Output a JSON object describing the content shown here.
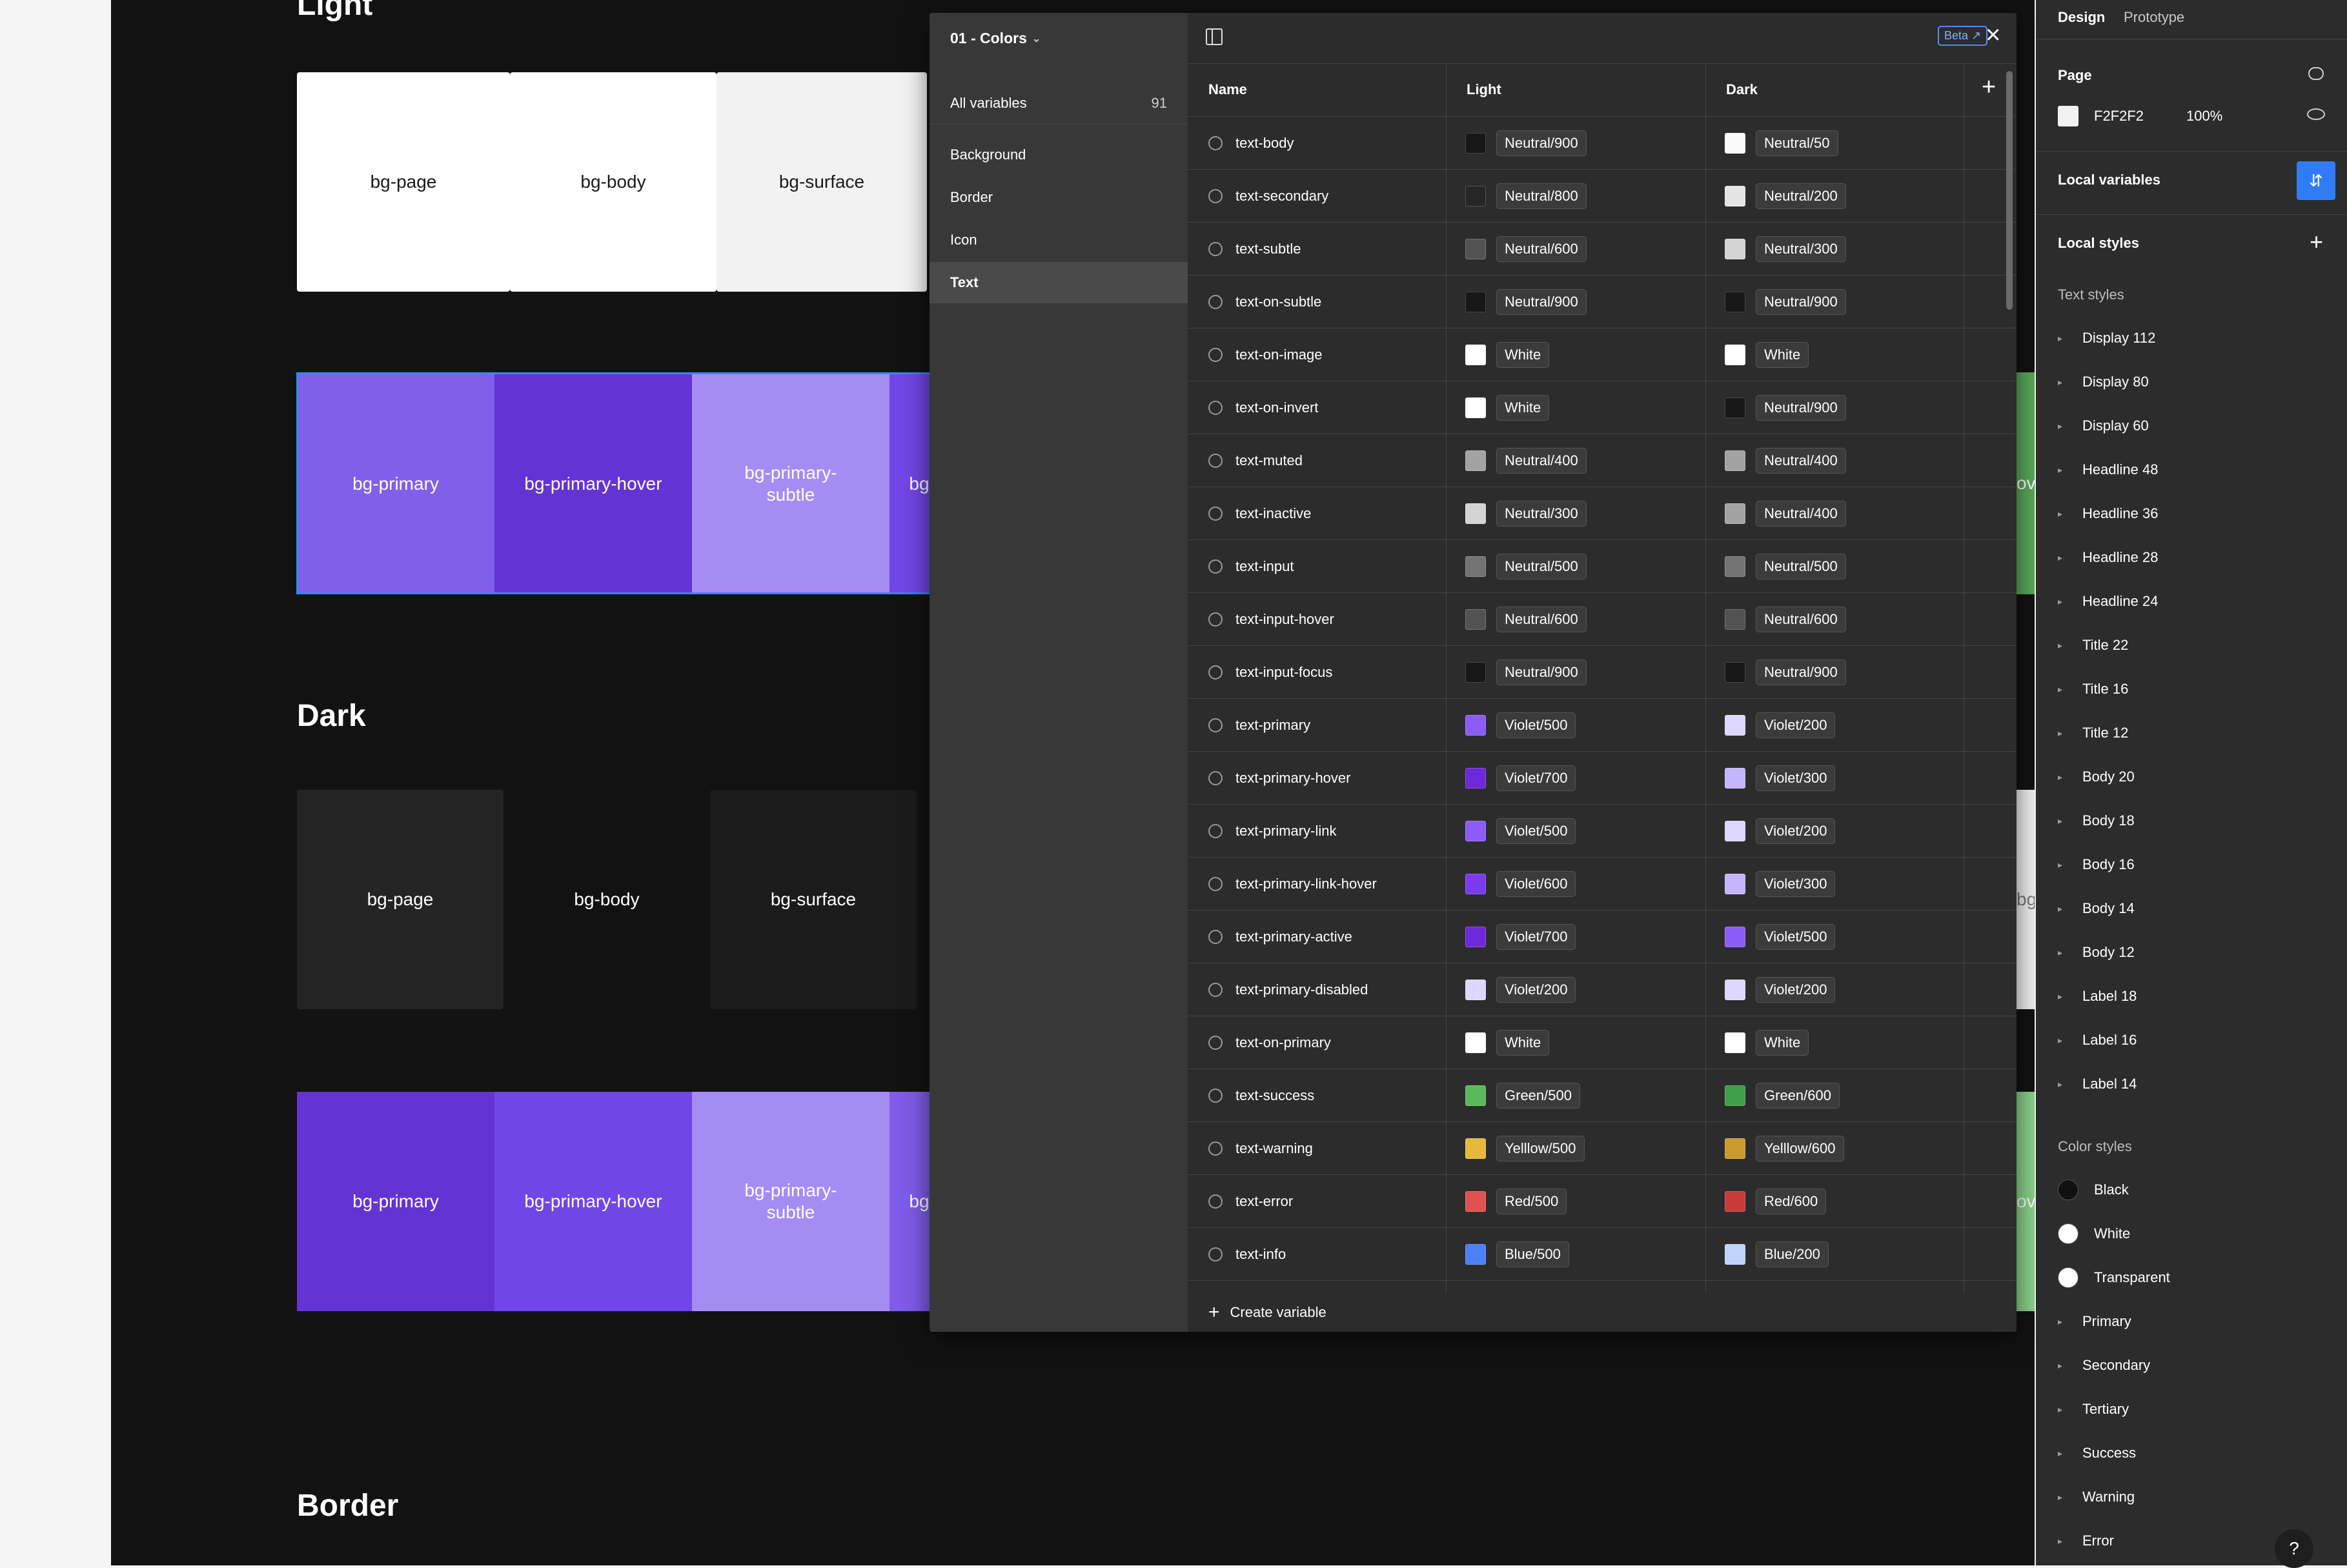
{
  "canvas": {
    "sections": {
      "light": "Light",
      "dark": "Dark",
      "border": "Border"
    },
    "light_neutral": [
      {
        "label": "bg-page",
        "bg": "#ffffff",
        "fg": "#1a1a1a"
      },
      {
        "label": "bg-body",
        "bg": "#ffffff",
        "fg": "#1a1a1a"
      },
      {
        "label": "bg-surface",
        "bg": "#f2f2f2",
        "fg": "#1a1a1a"
      }
    ],
    "light_primary": [
      {
        "label": "bg-primary",
        "bg": "#8060ea",
        "fg": "#ffffff"
      },
      {
        "label": "bg-primary-hover",
        "bg": "#6433d4",
        "fg": "#ffffff"
      },
      {
        "label": "bg-primary-\nsubtle",
        "bg": "#a48cf3",
        "fg": "#ffffff"
      },
      {
        "label": "bg",
        "bg": "#7146e6",
        "fg": "#ffffff"
      }
    ],
    "dark_neutral": [
      {
        "label": "bg-page",
        "bg": "#242424",
        "fg": "#ffffff"
      },
      {
        "label": "bg-body",
        "bg": "#121212",
        "fg": "#ffffff"
      },
      {
        "label": "bg-surface",
        "bg": "#1b1b1b",
        "fg": "#ffffff"
      }
    ],
    "dark_primary": [
      {
        "label": "bg-primary",
        "bg": "#6433d4",
        "fg": "#ffffff"
      },
      {
        "label": "bg-primary-hover",
        "bg": "#7146e6",
        "fg": "#ffffff"
      },
      {
        "label": "bg-primary-\nsubtle",
        "bg": "#a48cf3",
        "fg": "#ffffff"
      },
      {
        "label": "bg",
        "bg": "#7f5ce9",
        "fg": "#ffffff"
      }
    ],
    "peek_right": [
      "ov",
      "bg",
      "ov"
    ]
  },
  "modal": {
    "collection": "01 - Colors",
    "all_variables": "All variables",
    "count": "91",
    "groups": [
      "Background",
      "Border",
      "Icon",
      "Text"
    ],
    "active_group": "Text",
    "beta": "Beta",
    "columns": {
      "name": "Name",
      "light": "Light",
      "dark": "Dark"
    },
    "create": "Create variable",
    "rows": [
      {
        "name": "text-body",
        "light": "Neutral/900",
        "lc": "#171717",
        "dark": "Neutral/50",
        "dc": "#fafafa"
      },
      {
        "name": "text-secondary",
        "light": "Neutral/800",
        "lc": "#262626",
        "dark": "Neutral/200",
        "dc": "#e5e5e5"
      },
      {
        "name": "text-subtle",
        "light": "Neutral/600",
        "lc": "#525252",
        "dark": "Neutral/300",
        "dc": "#d4d4d4"
      },
      {
        "name": "text-on-subtle",
        "light": "Neutral/900",
        "lc": "#171717",
        "dark": "Neutral/900",
        "dc": "#171717"
      },
      {
        "name": "text-on-image",
        "light": "White",
        "lc": "#ffffff",
        "dark": "White",
        "dc": "#ffffff"
      },
      {
        "name": "text-on-invert",
        "light": "White",
        "lc": "#ffffff",
        "dark": "Neutral/900",
        "dc": "#171717"
      },
      {
        "name": "text-muted",
        "light": "Neutral/400",
        "lc": "#a3a3a3",
        "dark": "Neutral/400",
        "dc": "#a3a3a3"
      },
      {
        "name": "text-inactive",
        "light": "Neutral/300",
        "lc": "#d4d4d4",
        "dark": "Neutral/400",
        "dc": "#a3a3a3"
      },
      {
        "name": "text-input",
        "light": "Neutral/500",
        "lc": "#737373",
        "dark": "Neutral/500",
        "dc": "#737373"
      },
      {
        "name": "text-input-hover",
        "light": "Neutral/600",
        "lc": "#525252",
        "dark": "Neutral/600",
        "dc": "#525252"
      },
      {
        "name": "text-input-focus",
        "light": "Neutral/900",
        "lc": "#171717",
        "dark": "Neutral/900",
        "dc": "#171717"
      },
      {
        "name": "text-primary",
        "light": "Violet/500",
        "lc": "#8b5cf6",
        "dark": "Violet/200",
        "dc": "#ddd6fe"
      },
      {
        "name": "text-primary-hover",
        "light": "Violet/700",
        "lc": "#6d28d9",
        "dark": "Violet/300",
        "dc": "#c4b5fd"
      },
      {
        "name": "text-primary-link",
        "light": "Violet/500",
        "lc": "#8b5cf6",
        "dark": "Violet/200",
        "dc": "#ddd6fe"
      },
      {
        "name": "text-primary-link-hover",
        "light": "Violet/600",
        "lc": "#7c3aed",
        "dark": "Violet/300",
        "dc": "#c4b5fd"
      },
      {
        "name": "text-primary-active",
        "light": "Violet/700",
        "lc": "#6d28d9",
        "dark": "Violet/500",
        "dc": "#8b5cf6"
      },
      {
        "name": "text-primary-disabled",
        "light": "Violet/200",
        "lc": "#ddd6fe",
        "dark": "Violet/200",
        "dc": "#ddd6fe"
      },
      {
        "name": "text-on-primary",
        "light": "White",
        "lc": "#ffffff",
        "dark": "White",
        "dc": "#ffffff"
      },
      {
        "name": "text-success",
        "light": "Green/500",
        "lc": "#5cb85c",
        "dark": "Green/600",
        "dc": "#3f9e4a"
      },
      {
        "name": "text-warning",
        "light": "Yelllow/500",
        "lc": "#e6b83c",
        "dark": "Yelllow/600",
        "dc": "#c99a2e"
      },
      {
        "name": "text-error",
        "light": "Red/500",
        "lc": "#e05252",
        "dark": "Red/600",
        "dc": "#c93a3a"
      },
      {
        "name": "text-info",
        "light": "Blue/500",
        "lc": "#4d7ff5",
        "dark": "Blue/200",
        "dc": "#bfd3fe"
      }
    ]
  },
  "right": {
    "tabs": [
      "Design",
      "Prototype"
    ],
    "page_label": "Page",
    "page_color": "F2F2F2",
    "page_opacity": "100%",
    "local_variables": "Local variables",
    "local_styles": "Local styles",
    "text_styles_label": "Text styles",
    "text_styles": [
      "Display 112",
      "Display 80",
      "Display 60",
      "Headline 48",
      "Headline 36",
      "Headline 28",
      "Headline 24",
      "Title 22",
      "Title 16",
      "Title 12",
      "Body 20",
      "Body 18",
      "Body 16",
      "Body 14",
      "Body 12",
      "Label 18",
      "Label 16",
      "Label 14"
    ],
    "color_styles_label": "Color styles",
    "color_dots": [
      {
        "label": "Black",
        "color": "#111111"
      },
      {
        "label": "White",
        "color": "#ffffff"
      },
      {
        "label": "Transparent",
        "color": "#ffffff"
      }
    ],
    "color_groups": [
      "Primary",
      "Secondary",
      "Tertiary",
      "Success",
      "Warning",
      "Error"
    ],
    "help": "?"
  }
}
